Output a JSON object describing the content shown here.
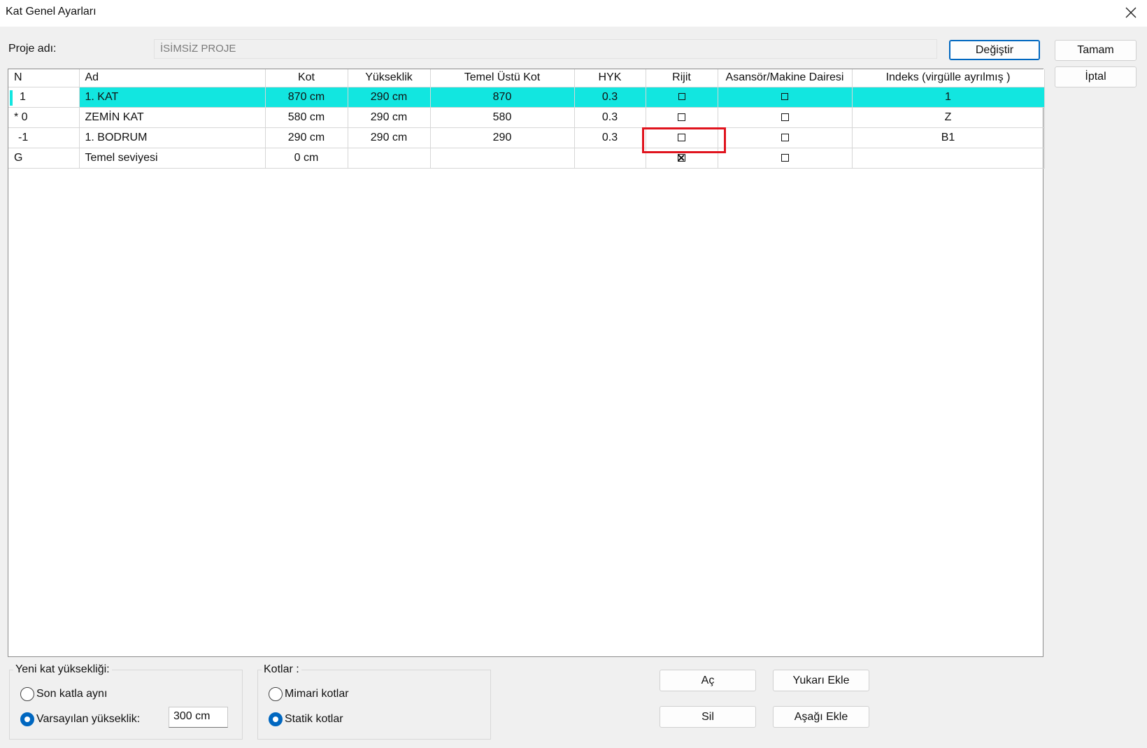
{
  "window": {
    "title": "Kat Genel Ayarları"
  },
  "project": {
    "label": "Proje adı:",
    "value": "İSİMSİZ PROJE",
    "change_button": "Değiştir"
  },
  "dialog_buttons": {
    "ok": "Tamam",
    "cancel": "İptal"
  },
  "grid": {
    "columns": [
      "N",
      "Ad",
      "Kot",
      "Yükseklik",
      "Temel Üstü Kot",
      "HYK",
      "Rijit",
      "Asansör/Makine Dairesi",
      "Indeks (virgülle ayrılmış )"
    ],
    "rows": [
      {
        "n": "1",
        "ad": "1. KAT",
        "kot": "870 cm",
        "yukseklik": "290 cm",
        "temel_ustu_kot": "870",
        "hyk": "0.3",
        "rijit": false,
        "asansor": false,
        "indeks": "1",
        "selected": true
      },
      {
        "n": "* 0",
        "ad": "ZEMİN KAT",
        "kot": "580 cm",
        "yukseklik": "290 cm",
        "temel_ustu_kot": "580",
        "hyk": "0.3",
        "rijit": false,
        "asansor": false,
        "indeks": "Z",
        "selected": false
      },
      {
        "n": "-1",
        "ad": "1. BODRUM",
        "kot": "290 cm",
        "yukseklik": "290 cm",
        "temel_ustu_kot": "290",
        "hyk": "0.3",
        "rijit": false,
        "asansor": false,
        "indeks": "B1",
        "selected": false
      },
      {
        "n": "G",
        "ad": "Temel seviyesi",
        "kot": "0 cm",
        "yukseklik": "",
        "temel_ustu_kot": "",
        "hyk": "",
        "rijit": true,
        "asansor": false,
        "indeks": "",
        "selected": false
      }
    ]
  },
  "new_floor_height": {
    "title": "Yeni kat yüksekliği:",
    "option_same": "Son katla aynı",
    "option_default": "Varsayılan yükseklik:",
    "selected": "default",
    "default_value": "300 cm"
  },
  "kotlar": {
    "title": "Kotlar :",
    "option_mimari": "Mimari kotlar",
    "option_statik": "Statik kotlar",
    "selected": "statik"
  },
  "actions": {
    "open": "Aç",
    "add_above": "Yukarı Ekle",
    "delete": "Sil",
    "add_below": "Aşağı Ekle"
  },
  "colors": {
    "selected_row": "#12e6e0",
    "highlight": "#e0141e",
    "accent": "#0067c0"
  }
}
